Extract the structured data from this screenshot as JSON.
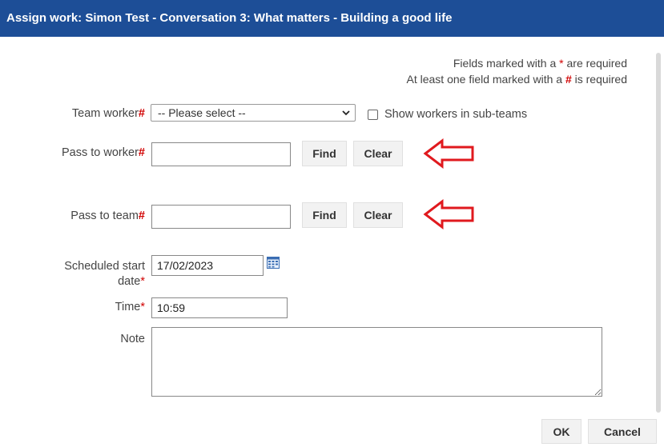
{
  "dialog": {
    "title": "Assign work: Simon Test - Conversation 3: What matters - Building a good life"
  },
  "notes": {
    "required_prefix": "Fields marked with a ",
    "required_marker": "*",
    "required_suffix": " are required",
    "one_field_prefix": "At least one field marked with a ",
    "one_field_marker": "#",
    "one_field_suffix": " is required"
  },
  "form": {
    "team_worker": {
      "label": "Team worker",
      "marker": "#",
      "value": "-- Please select --"
    },
    "sub_teams": {
      "label": "Show workers in sub-teams",
      "checked": false
    },
    "pass_to_worker": {
      "label": "Pass to worker",
      "marker": "#",
      "value": "",
      "find": "Find",
      "clear": "Clear"
    },
    "pass_to_team": {
      "label": "Pass to team",
      "marker": "#",
      "value": "",
      "find": "Find",
      "clear": "Clear"
    },
    "scheduled_start": {
      "label_line1": "Scheduled start",
      "label_line2": "date",
      "marker": "*",
      "value": "17/02/2023"
    },
    "time": {
      "label": "Time",
      "marker": "*",
      "value": "10:59"
    },
    "note": {
      "label": "Note",
      "value": ""
    }
  },
  "footer": {
    "ok": "OK",
    "cancel": "Cancel"
  },
  "colors": {
    "title_bg": "#1d4e97",
    "required": "#d10000",
    "annotation_arrow": "#e0191e"
  }
}
